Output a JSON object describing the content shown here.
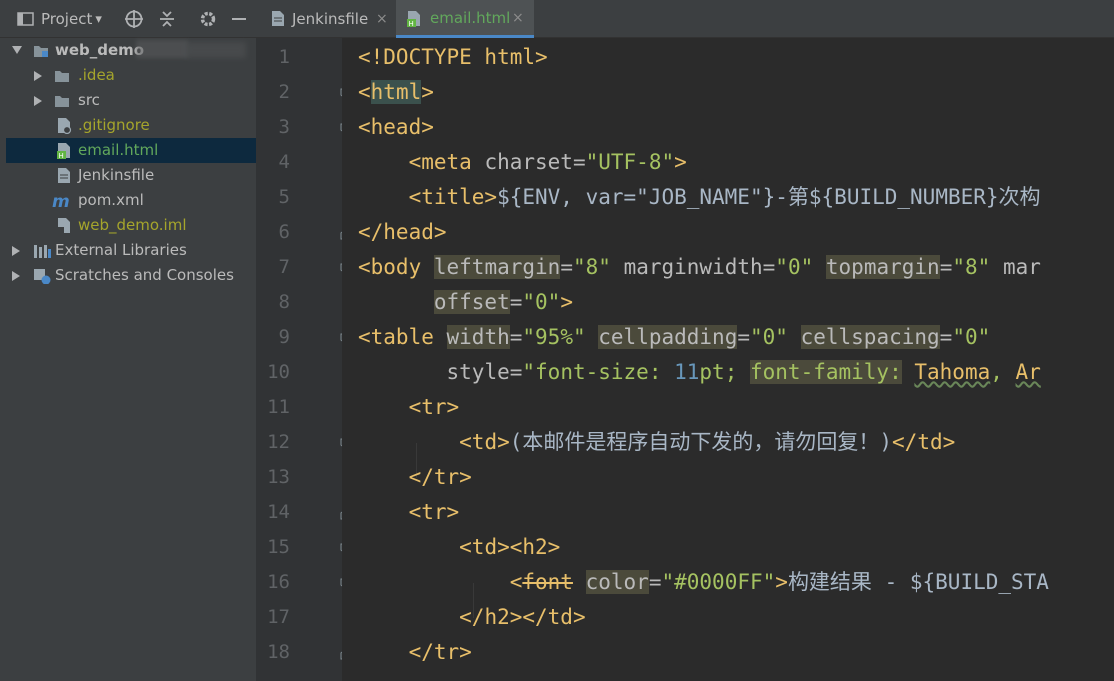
{
  "project_panel": {
    "title": "Project",
    "dropdown_glyph": "▾",
    "tree": [
      {
        "label": "web_demo",
        "color": "#bbbbbb",
        "bold": true
      },
      {
        "label": ".idea",
        "color": "#a5a52c"
      },
      {
        "label": "src",
        "color": "#bbbbbb"
      },
      {
        "label": ".gitignore",
        "color": "#a5a52c"
      },
      {
        "label": "email.html",
        "color": "#62a85c"
      },
      {
        "label": "Jenkinsfile",
        "color": "#bbbbbb"
      },
      {
        "label": "pom.xml",
        "color": "#bbbbbb"
      },
      {
        "label": "web_demo.iml",
        "color": "#a5a52c"
      },
      {
        "label": "External Libraries",
        "color": "#bbbbbb"
      },
      {
        "label": "Scratches and Consoles",
        "color": "#bbbbbb"
      }
    ]
  },
  "tabs": [
    {
      "label": "Jenkinsfile",
      "close": "×"
    },
    {
      "label": "email.html",
      "close": "×"
    }
  ],
  "icons": {
    "target": "crosshair-icon",
    "collapse": "collapse-all-icon",
    "settings": "gear-icon",
    "hide": "minimize-icon"
  },
  "code": {
    "line_numbers": [
      "1",
      "2",
      "3",
      "4",
      "5",
      "6",
      "7",
      "8",
      "9",
      "10",
      "11",
      "12",
      "13",
      "14",
      "15",
      "16",
      "17",
      "18"
    ],
    "l1": {
      "t": "<!DOCTYPE html>"
    },
    "l2": {
      "a": "<",
      "b": "html",
      "c": ">"
    },
    "l3": {
      "t": "<head>"
    },
    "l4": {
      "tag": "<meta",
      "attr": " charset",
      "eq": "=",
      "val": "\"UTF-8\"",
      "end": ">"
    },
    "l5": {
      "tag": "<title>",
      "text": "${ENV, var=\"JOB_NAME\"}-第${BUILD_NUMBER}次构"
    },
    "l6": {
      "t": "</head>"
    },
    "l7": {
      "tag": "<body",
      "a1": "leftmargin",
      "v1": "\"8\"",
      "a2": "marginwidth",
      "v2": "\"0\"",
      "a3": "topmargin",
      "v3": "\"8\"",
      "a4": "mar"
    },
    "l8": {
      "a": "offset",
      "v": "\"0\"",
      "end": ">"
    },
    "l9": {
      "tag": "<table",
      "a1": "width",
      "v1": "\"95%\"",
      "a2": "cellpadding",
      "v2": "\"0\"",
      "a3": "cellspacing",
      "v3": "\"0\""
    },
    "l10": {
      "a": "style",
      "q": "\"font-size: ",
      "n": "11",
      "u": "pt;",
      "p": "font-family:",
      "f1": "Tahoma",
      "c": ",",
      "f2": "Ar"
    },
    "l11": {
      "t": "<tr>"
    },
    "l12": {
      "open": "<td>",
      "text": "(本邮件是程序自动下发的，请勿回复！)",
      "close": "</td>"
    },
    "l13": {
      "t": "</tr>"
    },
    "l14": {
      "t": "<tr>"
    },
    "l15": {
      "t": "<td><h2>"
    },
    "l16": {
      "lt": "<",
      "tag": "font",
      "attr": "color",
      "val": "\"#0000FF\"",
      "end": ">",
      "text": "构建结果 - ${BUILD_STA"
    },
    "l17": {
      "t": "</h2></td>"
    },
    "l18": {
      "t": "</tr>"
    }
  },
  "colors": {
    "tag": "#e8bf6a",
    "attr": "#bababa",
    "value": "#a5c261",
    "text": "#a9b7c6",
    "accent": "#4a88c7"
  }
}
